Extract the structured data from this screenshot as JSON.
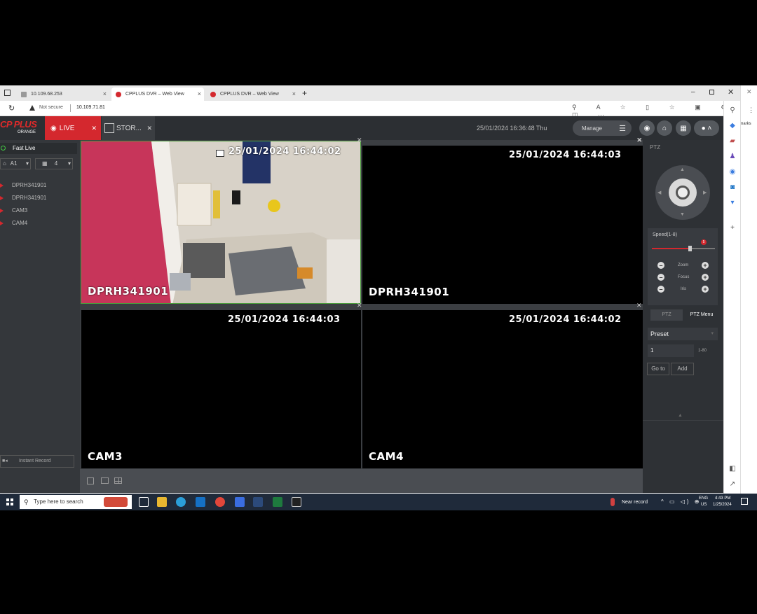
{
  "browser": {
    "tabs": [
      {
        "title": "10.109.68.253"
      },
      {
        "title": "CPPLUS DVR – Web View"
      },
      {
        "title": "CPPLUS DVR – Web View"
      }
    ],
    "security": "Not secure",
    "url": "10.109.71.81",
    "side_text": "narks"
  },
  "app": {
    "logo_text": "CP PLUS",
    "logo_sub": "ORANGE",
    "tabs": [
      {
        "label": "LIVE"
      },
      {
        "label": "STOR..."
      }
    ],
    "datetime": "25/01/2024 16:36:48 Thu",
    "manage_label": "Manage"
  },
  "left_panel": {
    "fast_live": "Fast Live",
    "select_a": "A1",
    "select_b": "4",
    "cameras": [
      "DPRH341901",
      "DPRH341901",
      "CAM3",
      "CAM4"
    ],
    "instant_record": "Instant Record"
  },
  "tiles": [
    {
      "stamp": "25/01/2024  16:44:02",
      "label": "DPRH341901"
    },
    {
      "stamp": "25/01/2024  16:44:03",
      "label": "DPRH341901"
    },
    {
      "stamp": "25/01/2024  16:44:03",
      "label": "CAM3"
    },
    {
      "stamp": "25/01/2024  16:44:02",
      "label": "CAM4"
    }
  ],
  "ptz": {
    "header": "PTZ",
    "speed_label": "Speed(1-8)",
    "speed_value": "5",
    "speed_fraction": 0.6,
    "zoom": "Zoom",
    "focus": "Focus",
    "iris": "Iris",
    "tab_ptz": "PTZ",
    "tab_menu": "PTZ Menu",
    "preset_label": "Preset",
    "preset_value": "1",
    "preset_range": "1-80",
    "goto_label": "Go to",
    "add_label": "Add"
  },
  "taskbar": {
    "search_placeholder": "Type here to search",
    "weather": "Near record",
    "lang": "ENG",
    "region": "US",
    "time": "4:43 PM",
    "date": "1/25/2024"
  }
}
